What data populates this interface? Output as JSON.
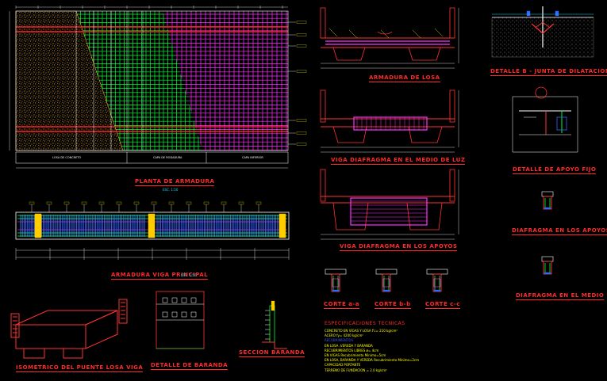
{
  "titles": {
    "planta": "PLANTA DE ARMADURA",
    "planta_scale": "ESC. 1:50",
    "armadura_losa": "ARMADURA DE LOSA",
    "junta": "DETALLE B - JUNTA DE DILATACION",
    "viga_medio": "VIGA DIAFRAGMA EN EL MEDIO DE LUZ",
    "apoyo_fijo": "DETALLE DE APOYO FIJO",
    "viga_apoyos": "VIGA DIAFRAGMA EN LOS APOYOS",
    "diaf_apoyos": "DIAFRAGMA EN LOS APOYOS",
    "armadura_viga": "ARMADURA VIGA PRINCIPAL",
    "armadura_viga_scale": "ESC. 1:50",
    "corte_aa": "CORTE a-a",
    "corte_bb": "CORTE b-b",
    "corte_cc": "CORTE c-c",
    "diaf_medio": "DIAFRAGMA EN EL MEDIO",
    "isometrico": "ISOMETRICO DEL PUENTE LOSA VIGA",
    "detalle_baranda": "DETALLE DE BARANDA",
    "seccion_baranda": "SECCION BARANDA"
  },
  "plan_labels": {
    "left": "LOSA DE CONCRETO",
    "center": "CAPA DE RODADURA",
    "right": "CAPA INFERIOR"
  },
  "spec": {
    "heading": "ESPECIFICACIONES TECNICAS",
    "lines": [
      {
        "t": "CONCRETO  EN VIGAS Y LOSA      f'c= 210 kg/cm²",
        "c": "#ffff00"
      },
      {
        "t": "ACERO                        fy= 4200 kg/cm²",
        "c": "#ffff00"
      },
      {
        "t": "          RECUBRIMIENTOS",
        "c": "#3355ff"
      },
      {
        "t": "     EN LOSA ,VEREDA Y BARANDA",
        "c": "#ffff00"
      },
      {
        "t": "RECUBRIMIENTOS LIBRES     ø= 4cm",
        "c": "#ffff00"
      },
      {
        "t": "    EN  VIGAS  Recubrimiento Minimo=5cm",
        "c": "#ffff00"
      },
      {
        "t": "    EN  LOSA, BARANDA Y VEREDA  Recubrimiento Minimo=2cm",
        "c": "#ffff00"
      },
      {
        "t": "CAPACIDAD PORTANTE",
        "c": "#ffff00"
      },
      {
        "t": "        TERRENO DE FUNDACION  = 2.0 kg/cm²",
        "c": "#ffff00"
      }
    ]
  },
  "colors": {
    "title": "#ff2a2a",
    "scale": "#00e0ff",
    "rebar_green": "#00ff33",
    "rebar_magenta": "#ff33ff",
    "concrete": "#e8a020",
    "outline": "#ff3333",
    "dimension": "#ffffff"
  }
}
